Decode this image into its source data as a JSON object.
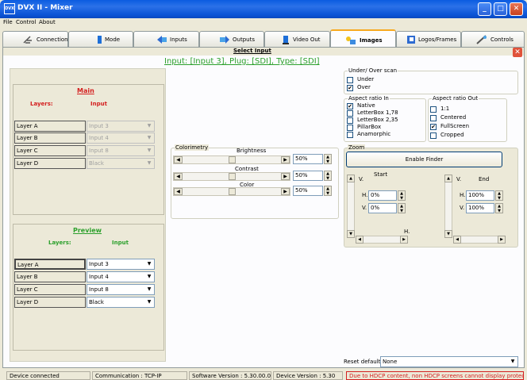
{
  "window": {
    "title": "DVX II - Mixer",
    "app_icon": "DVX"
  },
  "menu": [
    "File",
    "Control",
    "About"
  ],
  "tabs": [
    {
      "label": "Connection",
      "icon": "connection-icon"
    },
    {
      "label": "Mode",
      "icon": "mode-icon"
    },
    {
      "label": "Inputs",
      "icon": "inputs-icon"
    },
    {
      "label": "Outputs",
      "icon": "outputs-icon"
    },
    {
      "label": "Video Out",
      "icon": "video-out-icon"
    },
    {
      "label": "Images",
      "icon": "images-icon",
      "active": true
    },
    {
      "label": "Logos/Frames",
      "icon": "logos-frames-icon"
    },
    {
      "label": "Controls",
      "icon": "controls-icon"
    }
  ],
  "header": {
    "select_input": "Select Input",
    "input_line": "Input: [Input 3], Plug: [SDI], Type: [SDI]"
  },
  "main": {
    "title": "Main",
    "layers_header": "Layers:",
    "input_header": "Input",
    "rows": [
      {
        "layer": "Layer A",
        "input": "Input 3"
      },
      {
        "layer": "Layer B",
        "input": "Input 4"
      },
      {
        "layer": "Layer C",
        "input": "Input 8"
      },
      {
        "layer": "Layer D",
        "input": "Black"
      }
    ]
  },
  "preview": {
    "title": "Preview",
    "layers_header": "Layers:",
    "input_header": "Input",
    "rows": [
      {
        "layer": "Layer A",
        "input": "Input 3"
      },
      {
        "layer": "Layer B",
        "input": "Input 4"
      },
      {
        "layer": "Layer C",
        "input": "Input 8"
      },
      {
        "layer": "Layer D",
        "input": "Black"
      }
    ]
  },
  "colorimetry": {
    "title": "Colorimetry",
    "brightness": {
      "label": "Brightness",
      "value": "50%"
    },
    "contrast": {
      "label": "Contrast",
      "value": "50%"
    },
    "color": {
      "label": "Color",
      "value": "50%"
    }
  },
  "scan": {
    "title": "Under/ Over scan",
    "options": [
      {
        "label": "Under",
        "checked": false
      },
      {
        "label": "Over",
        "checked": true
      }
    ]
  },
  "aspect_in": {
    "title": "Aspect ratio In",
    "options": [
      {
        "label": "Native",
        "checked": true
      },
      {
        "label": "LetterBox 1,78",
        "checked": false
      },
      {
        "label": "LetterBox 2,35",
        "checked": false
      },
      {
        "label": "PillarBox",
        "checked": false
      },
      {
        "label": "Anamorphic",
        "checked": false
      }
    ]
  },
  "aspect_out": {
    "title": "Aspect ratio Out",
    "options": [
      {
        "label": "1:1",
        "checked": false
      },
      {
        "label": "Centered",
        "checked": false
      },
      {
        "label": "FullScreen",
        "checked": true
      },
      {
        "label": "Cropped",
        "checked": false
      }
    ]
  },
  "zoom": {
    "title": "Zoom",
    "finder_button": "Enable Finder",
    "start": {
      "label": "Start",
      "v_label": "V.",
      "h_field": "H.",
      "h_value": "0%",
      "v_field": "V.",
      "v_value": "0%",
      "h_axis": "H."
    },
    "end": {
      "label": "End",
      "v_label": "V.",
      "h_field": "H.",
      "h_value": "100%",
      "v_field": "V.",
      "v_value": "100%"
    }
  },
  "reset": {
    "label": "Reset default",
    "value": "None"
  },
  "status": {
    "connected": "Device connected",
    "communication": "Communication : TCP-IP",
    "software": "Software Version : 5.30.00.00",
    "device": "Device Version : 5.30",
    "warning": "Due to HDCP content, non HDCP screens cannot display protected"
  },
  "colors": {
    "title_blue": "#0a5ce0",
    "green": "#2ca02c",
    "red": "#d42020",
    "active_tab": "#f7a91f"
  }
}
